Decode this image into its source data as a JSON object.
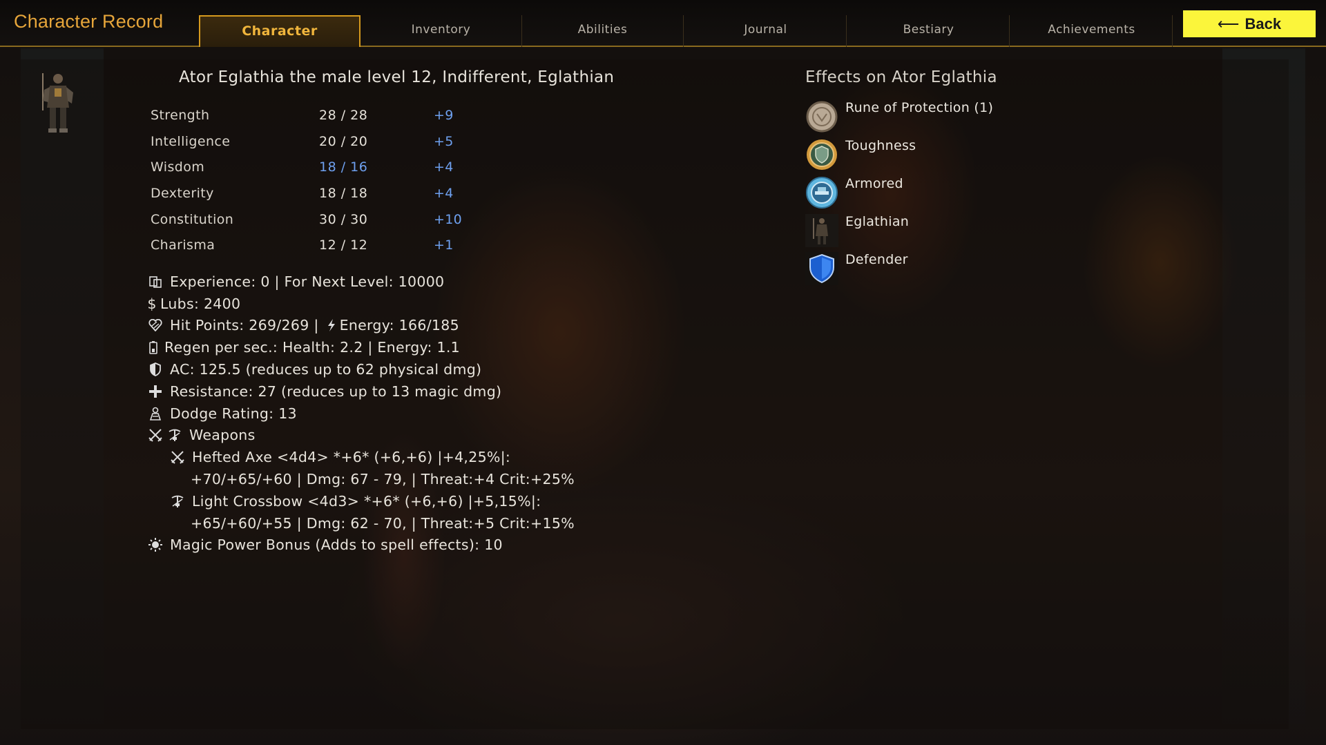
{
  "header": {
    "title": "Character Record",
    "tabs": [
      "Character",
      "Inventory",
      "Abilities",
      "Journal",
      "Bestiary",
      "Achievements"
    ],
    "active_tab": "Character",
    "back_label": "Back"
  },
  "character": {
    "heading": "Ator Eglathia the male level 12, Indifferent, Eglathian",
    "stats": [
      {
        "name": "Strength",
        "value": "28 / 28",
        "bonus": "+9"
      },
      {
        "name": "Intelligence",
        "value": "20 / 20",
        "bonus": "+5"
      },
      {
        "name": "Wisdom",
        "value": "18 / 16",
        "bonus": "+4",
        "highlight": true
      },
      {
        "name": "Dexterity",
        "value": "18 / 18",
        "bonus": "+4"
      },
      {
        "name": "Constitution",
        "value": "30 / 30",
        "bonus": "+10"
      },
      {
        "name": "Charisma",
        "value": "12 / 12",
        "bonus": "+1"
      }
    ],
    "experience": "Experience: 0 | For Next Level: 10000",
    "lubs": "Lubs: 2400",
    "hit_points": "Hit Points: 269/269 |",
    "energy": "Energy: 166/185",
    "regen": "Regen per sec.: Health: 2.2 | Energy: 1.1",
    "ac": "AC: 125.5 (reduces up to 62 physical dmg)",
    "resistance": "Resistance: 27 (reduces up to 13 magic dmg)",
    "dodge": "Dodge Rating: 13",
    "weapons_label": "Weapons",
    "weapons": [
      {
        "line1": "Hefted Axe <4d4> *+6* (+6,+6) |+4,25%|:",
        "line2": "+70/+65/+60 | Dmg: 67 - 79, | Threat:+4 Crit:+25%"
      },
      {
        "line1": "Light Crossbow <4d3> *+6* (+6,+6) |+5,15%|:",
        "line2": "+65/+60/+55 | Dmg: 62 - 70, | Threat:+5 Crit:+15%"
      }
    ],
    "magic_power": "Magic Power Bonus (Adds to spell effects): 10"
  },
  "effects": {
    "title": "Effects on Ator Eglathia",
    "items": [
      {
        "label": "Rune of Protection (1)",
        "icon": "rune-icon"
      },
      {
        "label": "Toughness",
        "icon": "toughness-icon"
      },
      {
        "label": "Armored",
        "icon": "armored-icon"
      },
      {
        "label": "Eglathian",
        "icon": "eglathian-icon"
      },
      {
        "label": "Defender",
        "icon": "shield-icon"
      }
    ]
  },
  "colors": {
    "accent_gold": "#e6a53a",
    "tab_border": "#d69a1e",
    "back_button": "#fbf53b",
    "stat_blue": "#6ea0ef"
  }
}
